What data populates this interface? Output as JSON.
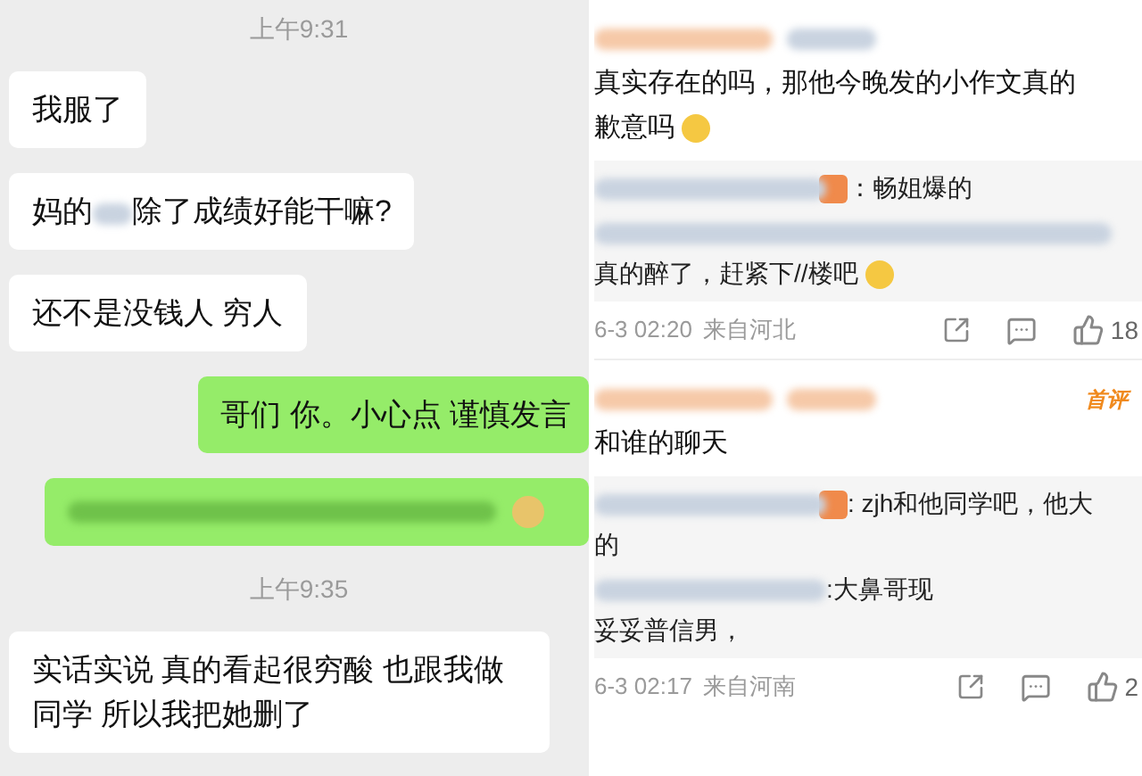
{
  "chat": {
    "items": [
      {
        "kind": "time",
        "text": "上午9:31"
      },
      {
        "kind": "incoming",
        "segments": [
          "我服了"
        ]
      },
      {
        "kind": "incoming",
        "segments": [
          "妈的",
          "除了成绩好能干嘛?"
        ]
      },
      {
        "kind": "incoming",
        "segments": [
          "还不是没钱人 穷人"
        ]
      },
      {
        "kind": "outgoing",
        "segments": [
          "哥们 你。小心点 谨慎发言"
        ]
      },
      {
        "kind": "outgoing",
        "blurred": true
      },
      {
        "kind": "time",
        "text": "上午9:35"
      },
      {
        "kind": "incoming",
        "segments": [
          "实话实说 真的看起很穷酸 也跟我做同学 所以我把她删了"
        ]
      }
    ]
  },
  "comments": [
    {
      "first_comment": false,
      "lines": [
        "真实存在的吗，那他今晚发的小作文真的",
        "歉意吗"
      ],
      "emoji": true,
      "replies": [
        {
          "kind": "inline",
          "badge": true,
          "lines": [
            "：畅姐爆的"
          ],
          "emoji": false
        },
        {
          "kind": "stacked",
          "badge": false,
          "lines": [
            "真的醉了，赶紧下//楼吧"
          ],
          "emoji": true
        }
      ],
      "time": "6-3 02:20",
      "location": "来自河北",
      "likes": "18"
    },
    {
      "first_comment": true,
      "badge_text": "首评",
      "lines": [
        "和谁的聊天"
      ],
      "emoji": false,
      "replies": [
        {
          "kind": "inline",
          "badge": true,
          "lines": [
            ": zjh和他同学吧，他大",
            "的"
          ],
          "emoji": false
        },
        {
          "kind": "inline",
          "badge": false,
          "lines": [
            ":大鼻哥现",
            "妥妥普信男，"
          ],
          "emoji": false
        }
      ],
      "time": "6-3 02:17",
      "location": "来自河南",
      "likes": "2"
    }
  ]
}
